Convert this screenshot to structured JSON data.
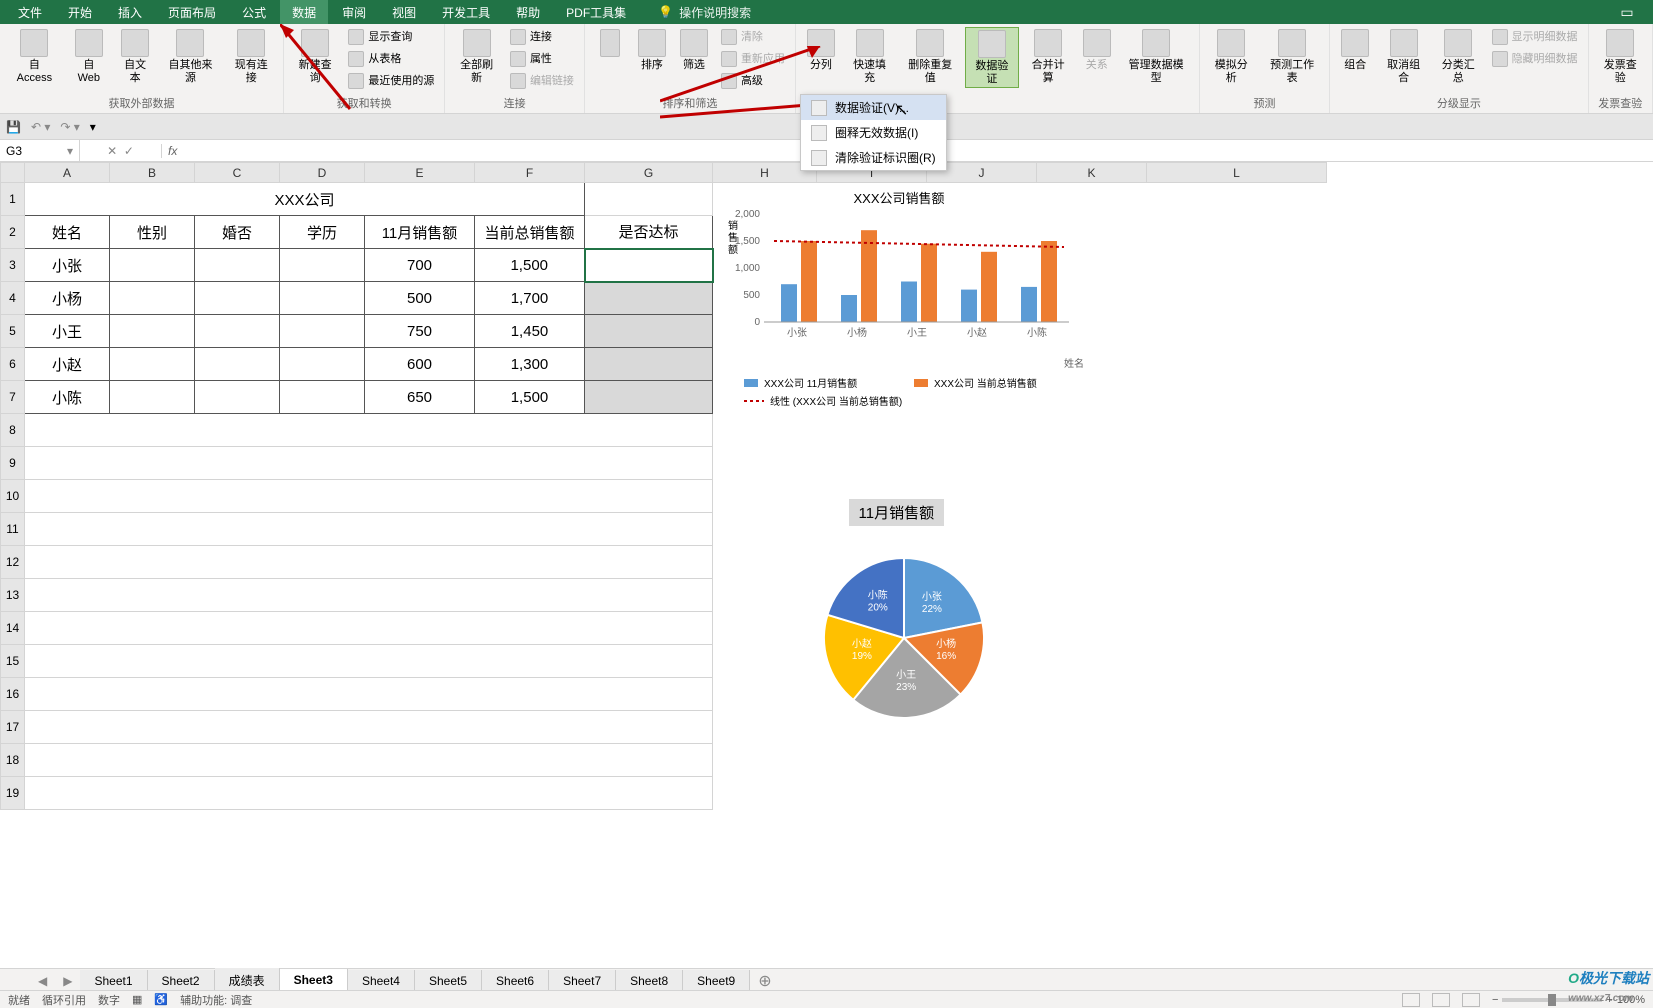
{
  "menu": {
    "tabs": [
      "文件",
      "开始",
      "插入",
      "页面布局",
      "公式",
      "数据",
      "审阅",
      "视图",
      "开发工具",
      "帮助",
      "PDF工具集"
    ],
    "active": 5,
    "search": "操作说明搜索"
  },
  "ribbon": {
    "groups": {
      "g0": {
        "label": "获取外部数据",
        "items": [
          "自 Access",
          "自 Web",
          "自文本",
          "自其他来源",
          "现有连接"
        ]
      },
      "g1": {
        "label": "获取和转换",
        "big": "新建查询",
        "items": [
          "显示查询",
          "从表格",
          "最近使用的源"
        ]
      },
      "g2": {
        "label": "连接",
        "big": "全部刷新",
        "items": [
          "连接",
          "属性",
          "编辑链接"
        ]
      },
      "g3": {
        "label": "排序和筛选",
        "b1": "排序",
        "b2": "筛选",
        "items": [
          "清除",
          "重新应用",
          "高级"
        ]
      },
      "g4": {
        "label": "数据工具",
        "items": [
          "分列",
          "快速填充",
          "删除重复值",
          "数据验证",
          "合并计算",
          "关系",
          "管理数据模型"
        ]
      },
      "g5": {
        "label": "预测",
        "items": [
          "模拟分析",
          "预测工作表"
        ]
      },
      "g6": {
        "label": "分级显示",
        "items": [
          "组合",
          "取消组合",
          "分类汇总"
        ],
        "side": [
          "显示明细数据",
          "隐藏明细数据"
        ]
      },
      "g7": {
        "label": "发票查验",
        "items": [
          "发票查验"
        ]
      }
    }
  },
  "dropdown": {
    "items": [
      "数据验证(V)...",
      "圈释无效数据(I)",
      "清除验证标识圈(R)"
    ]
  },
  "namebox": "G3",
  "table": {
    "title": "XXX公司",
    "headers": [
      "姓名",
      "性别",
      "婚否",
      "学历",
      "11月销售额",
      "当前总销售额",
      "是否达标"
    ],
    "rows": [
      {
        "name": "小张",
        "nov": "700",
        "total": "1,500"
      },
      {
        "name": "小杨",
        "nov": "500",
        "total": "1,700"
      },
      {
        "name": "小王",
        "nov": "750",
        "total": "1,450"
      },
      {
        "name": "小赵",
        "nov": "600",
        "total": "1,300"
      },
      {
        "name": "小陈",
        "nov": "650",
        "total": "1,500"
      }
    ]
  },
  "chart_data": [
    {
      "type": "bar",
      "title": "XXX公司销售额",
      "ylabel": "销售额",
      "xlabel": "姓名",
      "categories": [
        "小张",
        "小杨",
        "小王",
        "小赵",
        "小陈"
      ],
      "series": [
        {
          "name": "XXX公司 11月销售额",
          "values": [
            700,
            500,
            750,
            600,
            650
          ],
          "color": "#5b9bd5"
        },
        {
          "name": "XXX公司 当前总销售额",
          "values": [
            1500,
            1700,
            1450,
            1300,
            1500
          ],
          "color": "#ed7d31"
        }
      ],
      "trend": {
        "name": "线性 (XXX公司 当前总销售额)",
        "color": "#c00000"
      },
      "ylim": [
        0,
        2000
      ],
      "yticks": [
        0,
        500,
        1000,
        1500,
        2000
      ]
    },
    {
      "type": "pie",
      "title": "11月销售额",
      "categories": [
        "小张",
        "小杨",
        "小王",
        "小赵",
        "小陈"
      ],
      "values": [
        700,
        500,
        750,
        600,
        650
      ],
      "percent": [
        "22%",
        "16%",
        "23%",
        "19%",
        "20%"
      ],
      "colors": [
        "#5b9bd5",
        "#ed7d31",
        "#a5a5a5",
        "#ffc000",
        "#4472c4"
      ]
    }
  ],
  "sheets": {
    "tabs": [
      "Sheet1",
      "Sheet2",
      "成绩表",
      "Sheet3",
      "Sheet4",
      "Sheet5",
      "Sheet6",
      "Sheet7",
      "Sheet8",
      "Sheet9"
    ],
    "active": 3
  },
  "status": {
    "left": [
      "就绪",
      "循环引用",
      "数字",
      "辅助功能: 调查"
    ],
    "zoom": "100%"
  },
  "cols": [
    "",
    "A",
    "B",
    "C",
    "D",
    "E",
    "F",
    "G",
    "H",
    "I",
    "J",
    "K",
    "L"
  ],
  "watermark": "极光下载站",
  "watermark2": "www.xz7.com"
}
